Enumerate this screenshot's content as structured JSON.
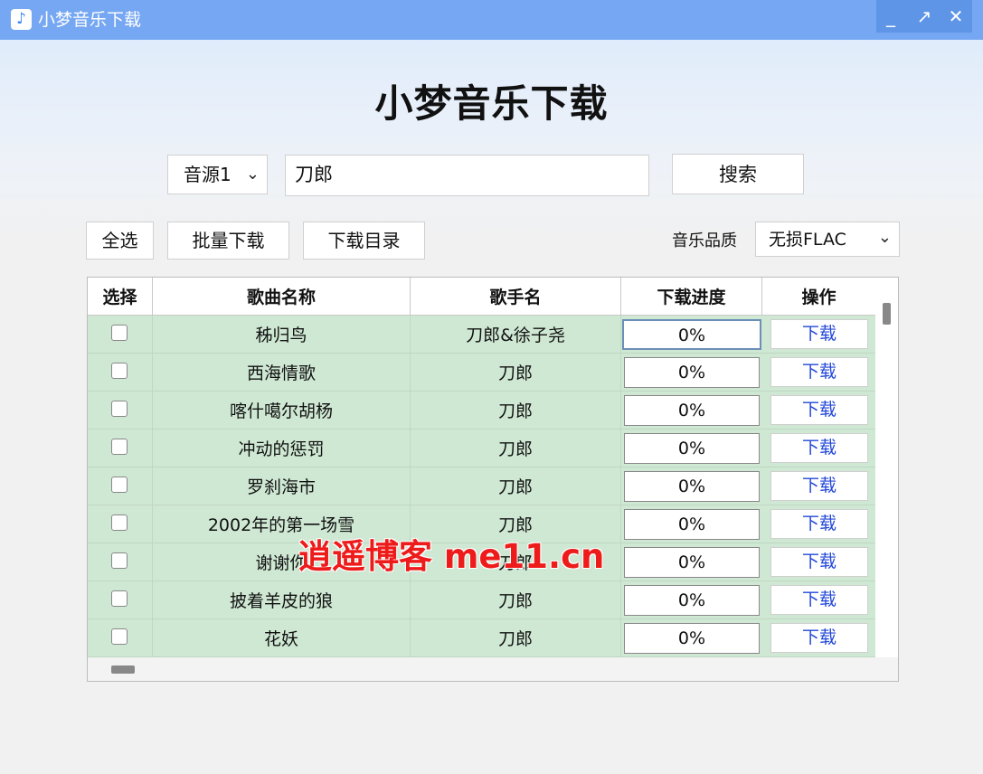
{
  "window": {
    "title": "小梦音乐下载",
    "icon": "music-note-icon",
    "minimize": "_",
    "maximize": "↗",
    "close": "✕"
  },
  "header": {
    "app_title": "小梦音乐下载"
  },
  "search": {
    "source": "音源1",
    "query": "刀郎",
    "button_label": "搜索"
  },
  "toolbar": {
    "select_all": "全选",
    "batch_download": "批量下载",
    "download_dir": "下载目录",
    "quality_label": "音乐品质",
    "quality_value": "无损FLAC"
  },
  "table": {
    "headers": [
      "选择",
      "歌曲名称",
      "歌手名",
      "下载进度",
      "操作"
    ],
    "rows": [
      {
        "song": "秭归鸟",
        "artist": "刀郎&徐子尧",
        "progress": "0%",
        "action": "下载"
      },
      {
        "song": "西海情歌",
        "artist": "刀郎",
        "progress": "0%",
        "action": "下载"
      },
      {
        "song": "喀什噶尔胡杨",
        "artist": "刀郎",
        "progress": "0%",
        "action": "下载"
      },
      {
        "song": "冲动的惩罚",
        "artist": "刀郎",
        "progress": "0%",
        "action": "下载"
      },
      {
        "song": "罗刹海市",
        "artist": "刀郎",
        "progress": "0%",
        "action": "下载"
      },
      {
        "song": "2002年的第一场雪",
        "artist": "刀郎",
        "progress": "0%",
        "action": "下载"
      },
      {
        "song": "谢谢你",
        "artist": "刀郎",
        "progress": "0%",
        "action": "下载"
      },
      {
        "song": "披着羊皮的狼",
        "artist": "刀郎",
        "progress": "0%",
        "action": "下载"
      },
      {
        "song": "花妖",
        "artist": "刀郎",
        "progress": "0%",
        "action": "下载"
      }
    ]
  },
  "watermark": "逍遥博客 me11.cn",
  "colors": {
    "titlebar": "#76a7f2",
    "row_bg": "#cfe8d3",
    "link_blue": "#2247d8",
    "watermark": "#ee1b1b"
  }
}
